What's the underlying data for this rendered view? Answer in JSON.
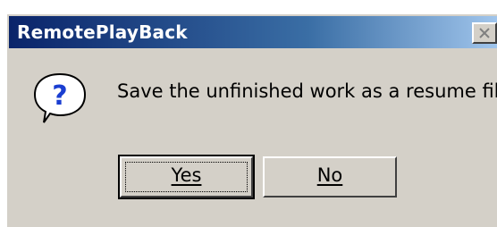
{
  "window": {
    "title": "RemotePlayBack",
    "close_icon": "close-icon"
  },
  "dialog": {
    "icon": "question-icon",
    "message": "Save the unfinished work as a resume file?",
    "buttons": {
      "yes_label": "Yes",
      "no_label": "No"
    }
  },
  "colors": {
    "titlebar_start": "#0a246a",
    "titlebar_end": "#a6caf0",
    "face": "#d4d0c8"
  }
}
